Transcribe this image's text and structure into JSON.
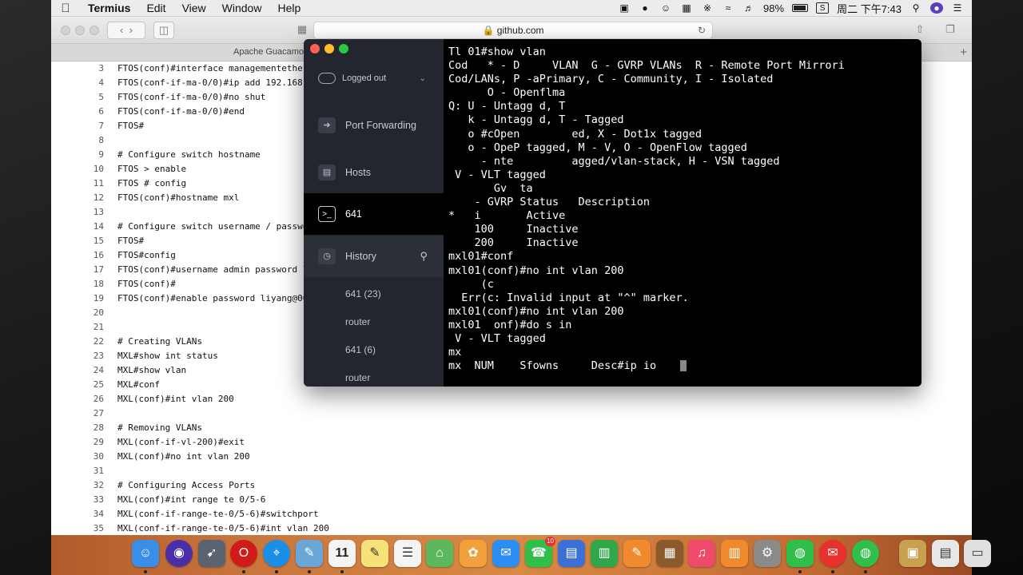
{
  "menubar": {
    "app_name": "Termius",
    "menus": [
      "Edit",
      "View",
      "Window",
      "Help"
    ],
    "battery": "98%",
    "clock": "周二 下午7:43"
  },
  "safari": {
    "url": "github.com",
    "tab_title": "Apache Guacamol"
  },
  "code_lines": [
    {
      "n": "3",
      "t": "FTOS(conf)#interface managementether"
    },
    {
      "n": "4",
      "t": "FTOS(conf-if-ma-0/0)#ip add 192.168."
    },
    {
      "n": "5",
      "t": "FTOS(conf-if-ma-0/0)#no shut"
    },
    {
      "n": "6",
      "t": "FTOS(conf-if-ma-0/0)#end"
    },
    {
      "n": "7",
      "t": "FTOS#"
    },
    {
      "n": "8",
      "t": ""
    },
    {
      "n": "9",
      "t": "# Configure switch hostname"
    },
    {
      "n": "10",
      "t": "FTOS > enable"
    },
    {
      "n": "11",
      "t": "FTOS # config"
    },
    {
      "n": "12",
      "t": "FTOS(conf)#hostname mxl"
    },
    {
      "n": "13",
      "t": ""
    },
    {
      "n": "14",
      "t": "# Configure switch username / passwo"
    },
    {
      "n": "15",
      "t": "FTOS#"
    },
    {
      "n": "16",
      "t": "FTOS#config"
    },
    {
      "n": "17",
      "t": "FTOS(conf)#username admin password l"
    },
    {
      "n": "18",
      "t": "FTOS(conf)#"
    },
    {
      "n": "19",
      "t": "FTOS(conf)#enable password liyang@00"
    },
    {
      "n": "20",
      "t": ""
    },
    {
      "n": "21",
      "t": ""
    },
    {
      "n": "22",
      "t": "# Creating VLANs"
    },
    {
      "n": "23",
      "t": "MXL#show int status"
    },
    {
      "n": "24",
      "t": "MXL#show vlan"
    },
    {
      "n": "25",
      "t": "MXL#conf"
    },
    {
      "n": "26",
      "t": "MXL(conf)#int vlan 200"
    },
    {
      "n": "27",
      "t": ""
    },
    {
      "n": "28",
      "t": "# Removing VLANs"
    },
    {
      "n": "29",
      "t": "MXL(conf-if-vl-200)#exit"
    },
    {
      "n": "30",
      "t": "MXL(conf)#no int vlan 200"
    },
    {
      "n": "31",
      "t": ""
    },
    {
      "n": "32",
      "t": "# Configuring Access Ports"
    },
    {
      "n": "33",
      "t": "MXL(conf)#int range te 0/5-6"
    },
    {
      "n": "34",
      "t": "MXL(conf-if-range-te-0/5-6)#switchport"
    },
    {
      "n": "35",
      "t": "MXL(conf-if-range-te-0/5-6)#int vlan 200"
    }
  ],
  "termius": {
    "account_status": "Logged out",
    "nav": {
      "port_forwarding": "Port Forwarding",
      "hosts": "Hosts",
      "active_session": "641",
      "history": "History"
    },
    "history_items": [
      "641 (23)",
      "router",
      "641 (6)",
      "router"
    ]
  },
  "terminal_lines": [
    "Tl 01#show vlan",
    "Cod   * - D     VLAN  G - GVRP VLANs  R - Remote Port Mirrori",
    "Cod/LANs, P -aPrimary, C - Community, I - Isolated",
    "      O - Openflma",
    "Q: U - Untagg d, T",
    "   k - Untagg d, T - Tagged",
    "   o #cOpen        ed, X - Dot1x tagged",
    "   o - OpeP tagged, M - V, O - OpenFlow tagged",
    "     - nte         agged/vlan-stack, H - VSN tagged",
    " V - VLT tagged",
    "       Gv  ta",
    "    - GVRP Status   Description",
    "*   i       Active",
    "    100     Inactive",
    "    200     Inactive",
    "mxl01#conf",
    "mxl01(conf)#no int vlan 200",
    "     (c",
    "  Err(c: Invalid input at \"^\" marker.",
    "mxl01(conf)#no int vlan 200",
    "mxl01  onf)#do s in",
    " V - VLT tagged",
    "mx",
    "mx  NUM    Sfowns     Desc#ip io"
  ],
  "dock": [
    "finder-icon",
    "siri-icon",
    "launchpad-icon",
    "opera-icon",
    "safari-icon",
    "preview-icon",
    "calendar-icon",
    "notes-icon",
    "reminders-icon",
    "maps-icon",
    "photos-icon",
    "messages-icon",
    "facetime-icon",
    "keynote-icon",
    "numbers-icon",
    "pages-icon",
    "archive-icon",
    "music-icon",
    "books-icon",
    "preferences-icon",
    "wechat-icon",
    "chat-icon",
    "wechat-green-icon",
    "box-icon",
    "document-icon",
    "trash-icon"
  ],
  "calendar_day": "11",
  "facetime_badge": "10"
}
